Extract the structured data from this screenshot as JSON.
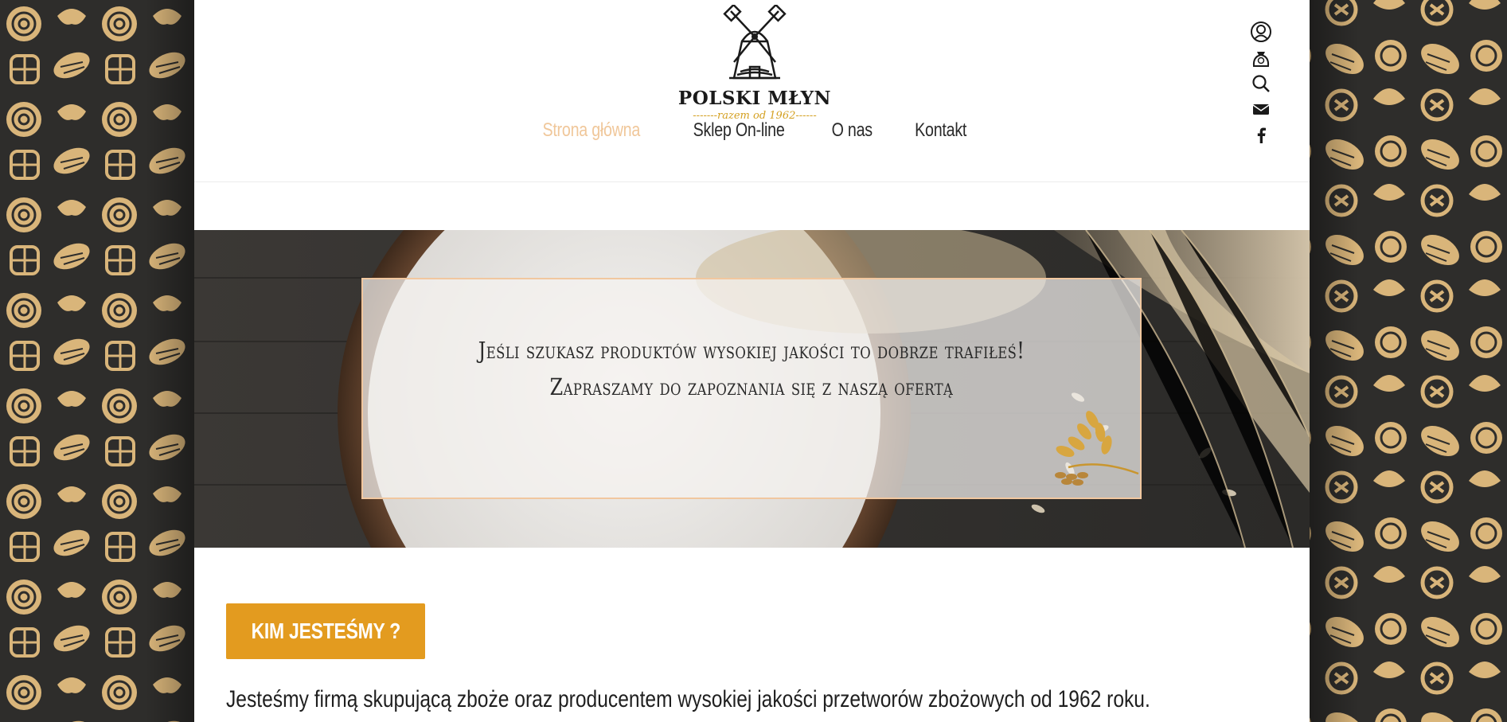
{
  "brand": {
    "name": "POLSKI MŁYN",
    "tagline": "-------razem od 1962------"
  },
  "nav": {
    "items": [
      "Strona główna",
      "Sklep On-line",
      "O nas",
      "Kontakt"
    ],
    "active_index": 0
  },
  "header_icons": [
    "user-icon",
    "cart-bag-icon",
    "search-icon",
    "mail-icon",
    "facebook-icon"
  ],
  "hero": {
    "text": "Jeśli szukasz produktów wysokiej jakości to dobrze trafiłeś! Zapraszamy do zapoznania się z naszą ofertą"
  },
  "about": {
    "button_label": "KIM JESTEŚMY ?",
    "intro": "Jesteśmy firmą skupującą zboże oraz producentem wysokiej jakości przetworów zbożowych od 1962 roku."
  },
  "colors": {
    "accent": "#e39b1f",
    "nav_active": "#f0c79a",
    "pattern_bg": "#2e2d2b",
    "pattern_item": "#d9b57a"
  }
}
